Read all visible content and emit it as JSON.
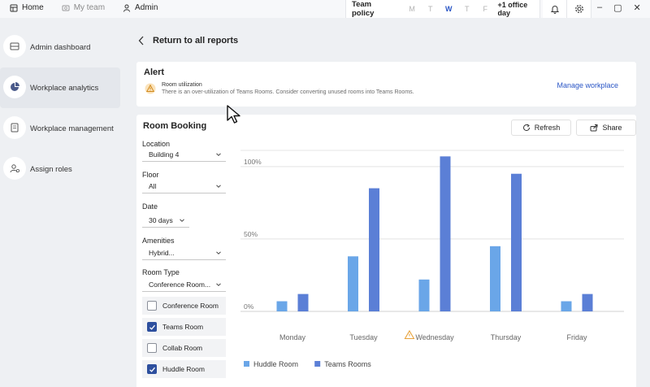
{
  "topnav": {
    "items": [
      {
        "label": "Home",
        "icon": "home-icon"
      },
      {
        "label": "My team",
        "icon": "team-icon"
      },
      {
        "label": "Admin",
        "icon": "admin-person-icon"
      }
    ]
  },
  "policy": {
    "title": "Team policy",
    "days": [
      "M",
      "T",
      "W",
      "T",
      "F"
    ],
    "active_day": "W",
    "extra": "+1 office day"
  },
  "sidebar": {
    "items": [
      {
        "label": "Admin dashboard",
        "icon": "dashboard-icon"
      },
      {
        "label": "Workplace analytics",
        "icon": "pie-chart-icon"
      },
      {
        "label": "Workplace management",
        "icon": "document-icon"
      },
      {
        "label": "Assign roles",
        "icon": "roles-icon"
      }
    ],
    "active": "Workplace analytics"
  },
  "back": {
    "label": "Return to all reports"
  },
  "alert": {
    "heading": "Alert",
    "title": "Room utilization",
    "message": "There is an over-utilization of Teams Rooms. Consider converting unused rooms into Teams Rooms.",
    "action": "Manage workplace",
    "warning_color": "#e8a33d"
  },
  "booking": {
    "title": "Room Booking",
    "refresh_label": "Refresh",
    "share_label": "Share",
    "filters": {
      "location": {
        "label": "Location",
        "value": "Building 4"
      },
      "floor": {
        "label": "Floor",
        "value": "All"
      },
      "date": {
        "label": "Date",
        "value": "30 days"
      },
      "amenities": {
        "label": "Amenities",
        "value": "Hybrid..."
      },
      "room_type": {
        "label": "Room Type",
        "value": "Conference Room..."
      }
    },
    "checkboxes": [
      {
        "label": "Conference Room",
        "checked": false
      },
      {
        "label": "Teams Room",
        "checked": true
      },
      {
        "label": "Collab Room",
        "checked": false
      },
      {
        "label": "Huddle Room",
        "checked": true
      }
    ]
  },
  "chart_data": {
    "type": "bar",
    "categories": [
      "Monday",
      "Tuesday",
      "Wednesday",
      "Thursday",
      "Friday"
    ],
    "warning_category": "Wednesday",
    "series": [
      {
        "name": "Huddle Room",
        "values": [
          7,
          38,
          22,
          45,
          7
        ],
        "color": "#6aa6e8"
      },
      {
        "name": "Teams Rooms",
        "values": [
          12,
          85,
          107,
          95,
          12
        ],
        "color": "#5b7fd6"
      }
    ],
    "yticks": [
      {
        "value": 0,
        "label": "0%"
      },
      {
        "value": 50,
        "label": "50%"
      },
      {
        "value": 100,
        "label": "100%"
      }
    ],
    "ylim": [
      0,
      110
    ],
    "legend_position": "bottom-left",
    "grid": true
  }
}
